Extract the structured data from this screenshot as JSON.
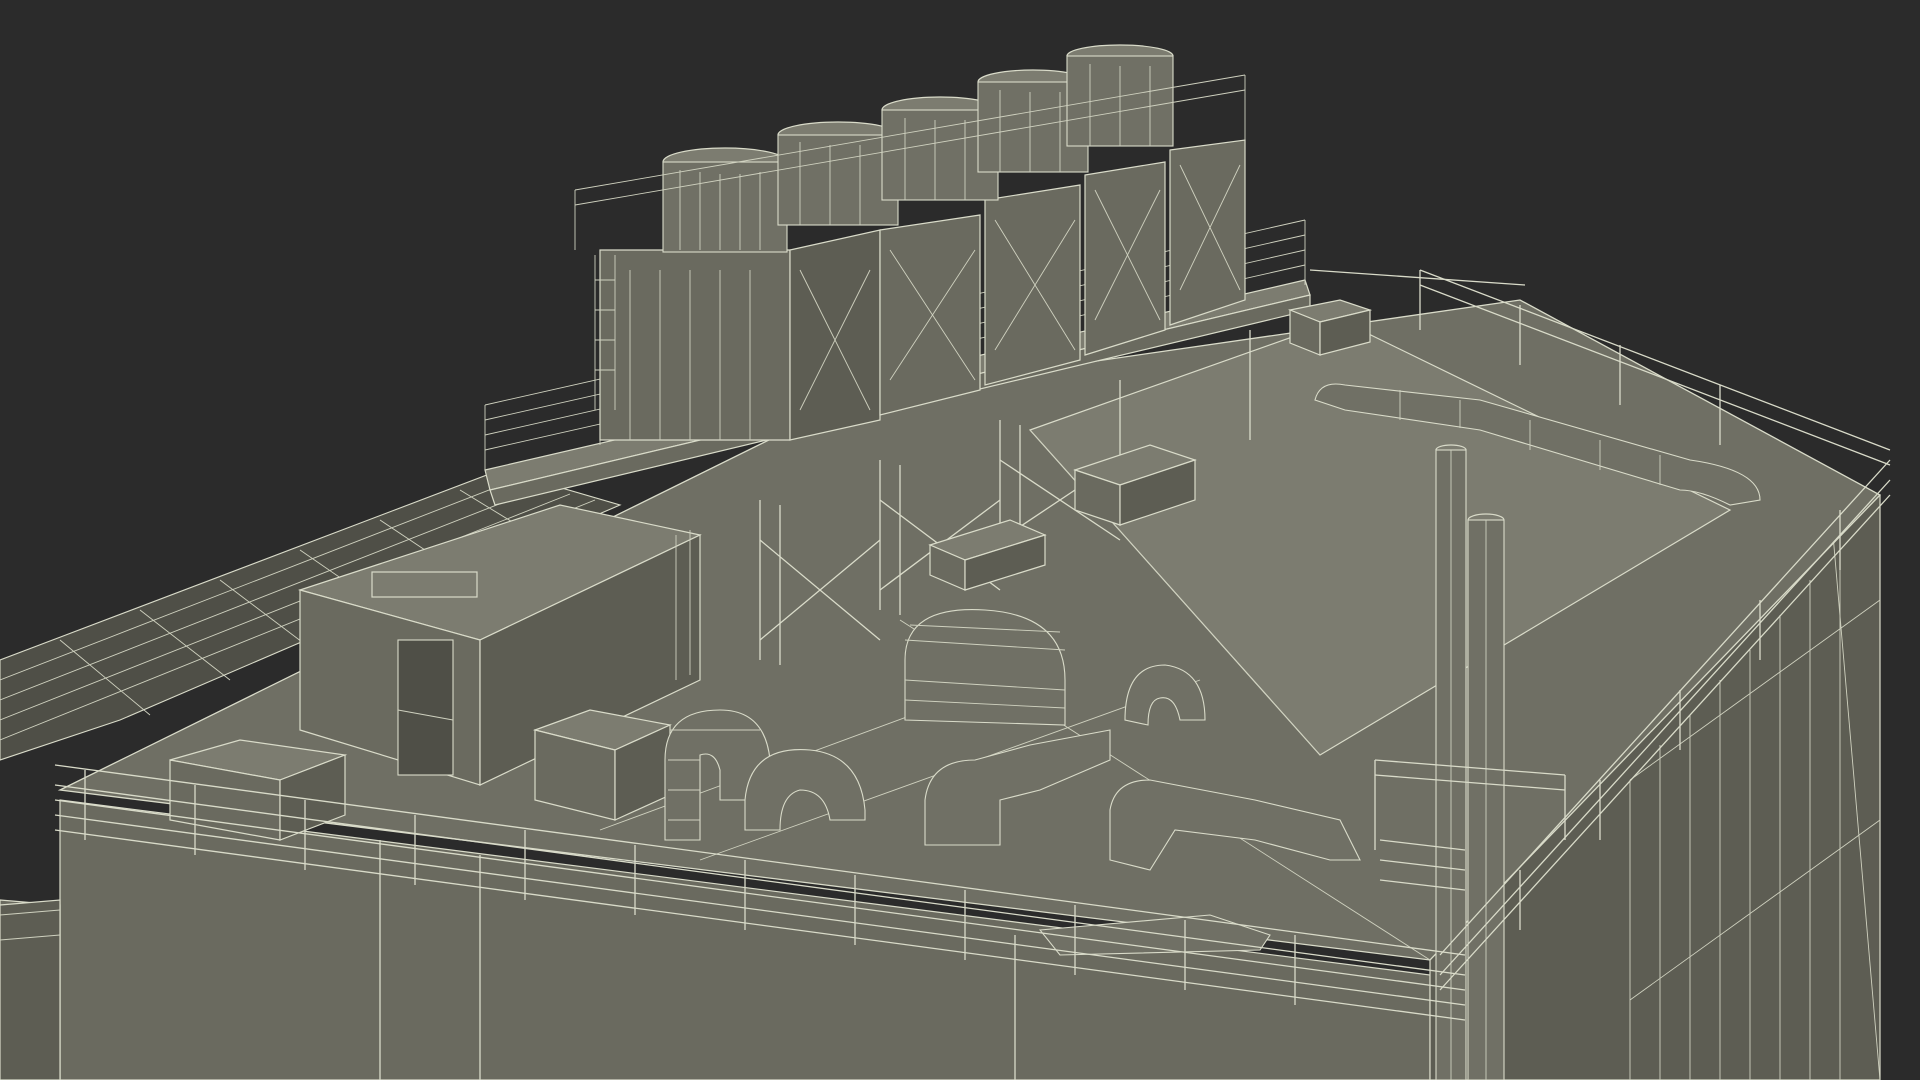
{
  "scene": {
    "background_color": "#2b2b2b",
    "model_face_color": "#6f6f64",
    "wire_color": "#d9dbc9",
    "cooling_tower_count": 5,
    "stack_count": 2
  }
}
